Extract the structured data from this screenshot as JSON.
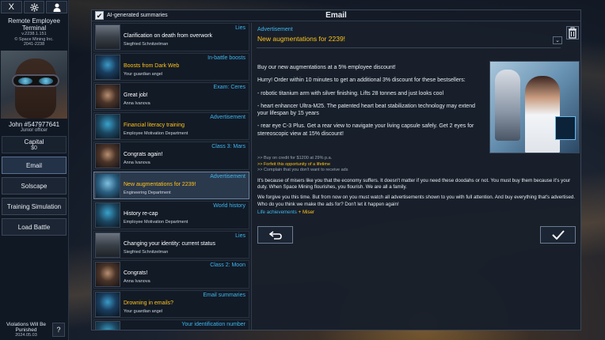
{
  "sidebar": {
    "top_icons": [
      {
        "label": "X",
        "icon": "close-icon"
      },
      {
        "label": "",
        "icon": "gear-icon"
      },
      {
        "label": "",
        "icon": "user-icon"
      }
    ],
    "terminal_title": "Remote Employee Terminal",
    "version": "v.2238.1.151",
    "company": "© Space Mining Inc.",
    "years": "2041-2238",
    "name": "John #547977641",
    "rank": "Junior officer",
    "capital_label": "Capital",
    "capital_value": "$0",
    "nav": [
      {
        "label": "Email",
        "active": true
      },
      {
        "label": "Solscape",
        "active": false
      },
      {
        "label": "Training Simulation",
        "active": false
      },
      {
        "label": "Load Battle",
        "active": false
      }
    ],
    "violations": "Violations Will Be Punished",
    "date": "2024.05.03",
    "help_label": "?"
  },
  "window": {
    "title": "Email",
    "ai_summaries_label": "AI-generated summaries",
    "ai_summaries_checked": true
  },
  "emails": [
    {
      "tag": "Lies",
      "subject": "Clarification on death from overwork",
      "sender": "Siegfried Schnitzelman",
      "avatar": "siegfried",
      "ad": false,
      "selected": false
    },
    {
      "tag": "In-battle boosts",
      "subject": "Boosts from Dark Web",
      "sender": "Your guardian angel",
      "avatar": "guardian",
      "ad": true,
      "selected": false
    },
    {
      "tag": "Exam: Ceres",
      "subject": "Great job!",
      "sender": "Anna Ivanova",
      "avatar": "anna",
      "ad": false,
      "selected": false
    },
    {
      "tag": "Advertisement",
      "subject": "Financial literacy training",
      "sender": "Employee Motivation Department",
      "avatar": "motiv",
      "ad": true,
      "selected": false
    },
    {
      "tag": "Class 3: Mars",
      "subject": "Congrats again!",
      "sender": "Anna Ivanova",
      "avatar": "anna",
      "ad": false,
      "selected": false
    },
    {
      "tag": "Advertisement",
      "subject": "New augmentations for 2239!",
      "sender": "Engineering Department",
      "avatar": "eng",
      "ad": true,
      "selected": true
    },
    {
      "tag": "World history",
      "subject": "History re-cap",
      "sender": "Employee Motivation Department",
      "avatar": "motiv",
      "ad": false,
      "selected": false
    },
    {
      "tag": "Lies",
      "subject": "Changing your identity: current status",
      "sender": "Siegfried Schnitzelman",
      "avatar": "siegfried",
      "ad": false,
      "selected": false
    },
    {
      "tag": "Class 2: Moon",
      "subject": "Congrats!",
      "sender": "Anna Ivanova",
      "avatar": "anna",
      "ad": false,
      "selected": false
    },
    {
      "tag": "Email summaries",
      "subject": "Drowning in emails?",
      "sender": "Your guardian angel",
      "avatar": "guardian",
      "ad": true,
      "selected": false
    },
    {
      "tag": "Your identification number",
      "subject": "",
      "sender": "",
      "avatar": "motiv",
      "ad": false,
      "selected": false
    }
  ],
  "detail": {
    "type": "Advertisement",
    "subject": "New augmentations for 2239!",
    "chevron": "⌄",
    "body": [
      "Buy our new augmentations at a 5% employee discount!",
      "Hurry! Order within 10 minutes to get an additional 3% discount for these bestsellers:",
      "- robotic titanium arm with silver finishing. Lifts 28 tonnes and just looks cool",
      "- heart enhancer Ultra-M25. The patented heart beat stabilization technology may extend your lifespan by 15 years",
      "- rear eye C-3 Plus. Get a rear view to navigate your living capsule safely. Get 2 eyes for stereoscopic view at 15% discount!"
    ],
    "status_lines": [
      ">> Buy on credit for $1200 at 29% p.a.",
      ">> Forfeit this opportunity of a lifetime",
      ">> Complain that you don't want to receive ads"
    ],
    "footer": [
      "It's because of misers like you that the economy suffers. It doesn't matter if you need these doodahs or not. You must buy them because it's your duty. When Space Mining flourishes, you flourish. We are all a family.",
      "We forgive you this time. But from now on you must watch all advertisements shown to you with full attention. And buy everything that's advertised. Who do you think we make the ads for? Don't let it happen again!"
    ],
    "life_label": "Life achievements",
    "life_value": "+ Miser"
  },
  "colors": {
    "accent_blue": "#3fb6ee",
    "accent_yellow": "#ffc21a",
    "panel": "#181f2a"
  }
}
